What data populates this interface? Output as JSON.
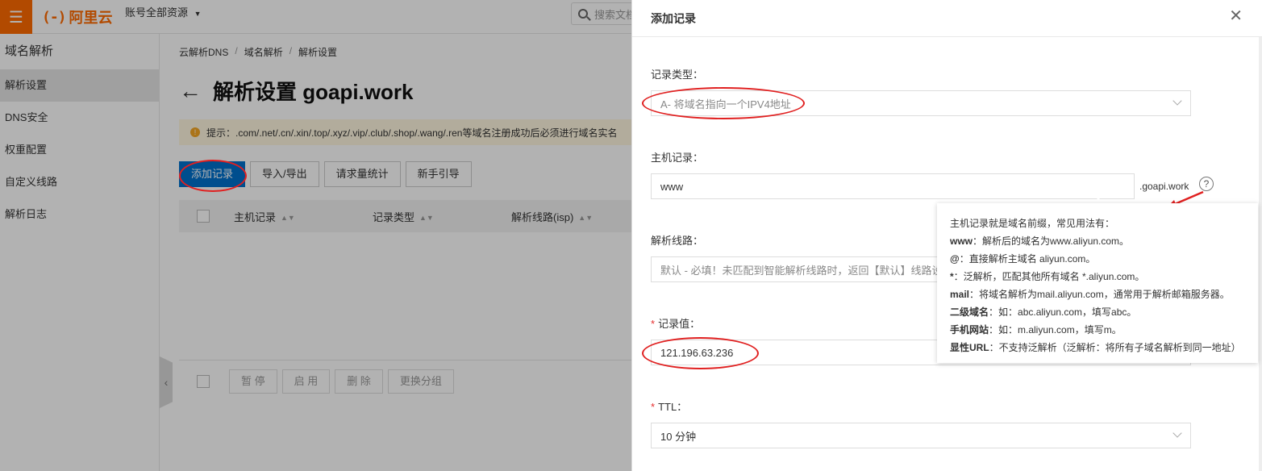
{
  "header": {
    "brand_mark": "(-)",
    "brand_name": "阿里云",
    "account_label": "账号全部资源",
    "search_placeholder": "搜索文档"
  },
  "sidebar": {
    "title": "域名解析",
    "items": [
      {
        "label": "解析设置",
        "active": true
      },
      {
        "label": "DNS安全"
      },
      {
        "label": "权重配置"
      },
      {
        "label": "自定义线路"
      },
      {
        "label": "解析日志"
      }
    ]
  },
  "breadcrumb": [
    "云解析DNS",
    "域名解析",
    "解析设置"
  ],
  "page_title": "解析设置 goapi.work",
  "notice": "提示：.com/.net/.cn/.xin/.top/.xyz/.vip/.club/.shop/.wang/.ren等域名注册成功后必须进行域名实名",
  "toolbar": {
    "add_record": "添加记录",
    "import_export": "导入/导出",
    "request_stats": "请求量统计",
    "guide": "新手引导"
  },
  "table": {
    "columns": [
      "主机记录",
      "记录类型",
      "解析线路(isp)"
    ]
  },
  "bottom_actions": [
    "暂 停",
    "启 用",
    "删 除",
    "更换分组"
  ],
  "dialog": {
    "title": "添加记录",
    "record_type_label": "记录类型：",
    "record_type_value": "A- 将域名指向一个IPV4地址",
    "host_label": "主机记录：",
    "host_value": "www",
    "host_suffix": ".goapi.work",
    "line_label": "解析线路：",
    "line_value": "默认 - 必填！未匹配到智能解析线路时，返回【默认】线路设置",
    "value_label": "记录值：",
    "value_value": "121.196.63.236",
    "ttl_label": "TTL：",
    "ttl_value": "10 分钟"
  },
  "tooltip": {
    "intro": "主机记录就是域名前缀，常见用法有：",
    "lines": [
      {
        "key": "www",
        "text": "：解析后的域名为www.aliyun.com。"
      },
      {
        "key": "@",
        "text": "：直接解析主域名 aliyun.com。"
      },
      {
        "key": "*",
        "text": "：泛解析，匹配其他所有域名 *.aliyun.com。"
      },
      {
        "key": "mail",
        "text": "：将域名解析为mail.aliyun.com，通常用于解析邮箱服务器。"
      },
      {
        "key": "二级域名",
        "text": "：如：abc.aliyun.com，填写abc。"
      },
      {
        "key": "手机网站",
        "text": "：如：m.aliyun.com，填写m。"
      },
      {
        "key": "显性URL",
        "text": "：不支持泛解析（泛解析：将所有子域名解析到同一地址）"
      }
    ]
  },
  "colors": {
    "brand": "#ff6a00",
    "primary": "#0070cc",
    "annotation": "#e02020"
  }
}
